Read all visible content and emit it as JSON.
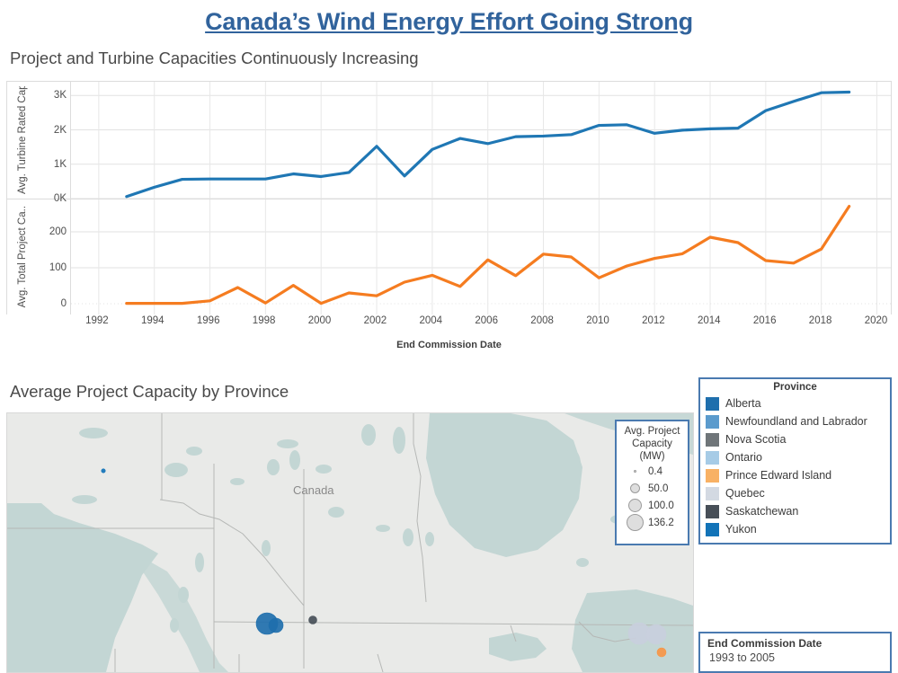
{
  "dashboard": {
    "title": "Canada’s Wind Energy Effort Going Strong",
    "chart_caption": "Project and Turbine Capacities Continuously Increasing",
    "map_caption": "Average Project Capacity by Province",
    "accent_color": "#31639c",
    "legend_border_color": "#4a7ab0"
  },
  "chart_data": [
    {
      "type": "line",
      "title": "Project and Turbine Capacities Continuously Increasing",
      "panel": "top",
      "xlabel": "End Commission Date",
      "ylabel": "Avg. Turbine Rated Capacity (kW)",
      "ylabel_display": "Avg. Turbine Rated Capacity (kW)",
      "ytick_labels": [
        "0K",
        "1K",
        "2K",
        "3K"
      ],
      "ytick_values": [
        0,
        1000,
        2000,
        3000
      ],
      "ylim": [
        0,
        3400
      ],
      "xlim": [
        1991,
        2020.5
      ],
      "xtick_labels": [
        "1992",
        "1994",
        "1996",
        "1998",
        "2000",
        "2002",
        "2004",
        "2006",
        "2008",
        "2010",
        "2012",
        "2014",
        "2016",
        "2018",
        "2020"
      ],
      "xtick_values": [
        1992,
        1994,
        1996,
        1998,
        2000,
        2002,
        2004,
        2006,
        2008,
        2010,
        2012,
        2014,
        2016,
        2018,
        2020
      ],
      "grid": true,
      "legend": "none",
      "color": "#1f77b4",
      "x": [
        1993,
        1994,
        1995,
        1996,
        1997,
        1998,
        1999,
        2000,
        2001,
        2002,
        2003,
        2004,
        2005,
        2006,
        2007,
        2008,
        2009,
        2010,
        2011,
        2012,
        2013,
        2014,
        2015,
        2016,
        2017,
        2018,
        2019
      ],
      "values": [
        60,
        330,
        560,
        570,
        570,
        570,
        720,
        640,
        760,
        1520,
        660,
        1430,
        1750,
        1600,
        1800,
        1820,
        1860,
        2130,
        2150,
        1900,
        1990,
        2030,
        2050,
        2560,
        2830,
        3080,
        3100
      ]
    },
    {
      "type": "line",
      "panel": "bottom",
      "xlabel": "End Commission Date",
      "ylabel": "Avg. Total Project Capacity (MW)",
      "ylabel_display": "Avg. Total Project Ca..",
      "ytick_labels": [
        "0",
        "100",
        "200"
      ],
      "ytick_values": [
        0,
        100,
        200
      ],
      "ylim": [
        -30,
        290
      ],
      "xlim": [
        1991,
        2020.5
      ],
      "grid": true,
      "legend": "none",
      "color": "#f57c20",
      "x": [
        1993,
        1994,
        1995,
        1996,
        1997,
        1998,
        1999,
        2000,
        2001,
        2002,
        2003,
        2004,
        2005,
        2006,
        2007,
        2008,
        2009,
        2010,
        2011,
        2012,
        2013,
        2014,
        2015,
        2016,
        2017,
        2018,
        2019
      ],
      "values": [
        1,
        1,
        1,
        8,
        45,
        2,
        51,
        1,
        30,
        22,
        60,
        79,
        48,
        122,
        78,
        138,
        130,
        72,
        105,
        126,
        139,
        185,
        170,
        120,
        113,
        152,
        271
      ]
    }
  ],
  "size_legend": {
    "title_lines": [
      "Avg. Project",
      "Capacity",
      "(MW)"
    ],
    "entries": [
      {
        "label": "0.4",
        "diameter": 3
      },
      {
        "label": "50.0",
        "diameter": 11
      },
      {
        "label": "100.0",
        "diameter": 15
      },
      {
        "label": "136.2",
        "diameter": 19
      }
    ]
  },
  "province_legend": {
    "title": "Province",
    "items": [
      {
        "label": "Alberta",
        "color": "#1f6fad"
      },
      {
        "label": "Newfoundland and Labrador",
        "color": "#5b9bcd"
      },
      {
        "label": "Nova Scotia",
        "color": "#6f7579"
      },
      {
        "label": "Ontario",
        "color": "#a6cbe6"
      },
      {
        "label": "Prince Edward Island",
        "color": "#f8b164"
      },
      {
        "label": "Quebec",
        "color": "#d3d9e2"
      },
      {
        "label": "Saskatchewan",
        "color": "#474f58"
      },
      {
        "label": "Yukon",
        "color": "#1273b8"
      }
    ]
  },
  "filter": {
    "title": "End Commission Date",
    "value": "1993 to 2005"
  },
  "map": {
    "country_label": "Canada",
    "land_color": "#e9eae8",
    "water_color": "#c3d6d4",
    "border_color": "#b6b8b6",
    "markers": [
      {
        "province": "Yukon",
        "cx": 107,
        "cy": 64,
        "r": 2.2,
        "color": "#1273b8"
      },
      {
        "province": "Alberta",
        "cx": 289,
        "cy": 234,
        "r": 12,
        "color": "#1f6fad"
      },
      {
        "province": "Alberta",
        "cx": 299,
        "cy": 236,
        "r": 8,
        "color": "#1f6fad"
      },
      {
        "province": "Saskatchewan",
        "cx": 340,
        "cy": 230,
        "r": 4.5,
        "color": "#474f58"
      },
      {
        "province": "Quebec",
        "cx": 703,
        "cy": 245,
        "r": 12,
        "color": "#c9cfdd"
      },
      {
        "province": "Quebec",
        "cx": 722,
        "cy": 246,
        "r": 11,
        "color": "#c9cfdd"
      },
      {
        "province": "Prince Edward Island",
        "cx": 728,
        "cy": 266,
        "r": 5,
        "color": "#f79646"
      }
    ]
  }
}
